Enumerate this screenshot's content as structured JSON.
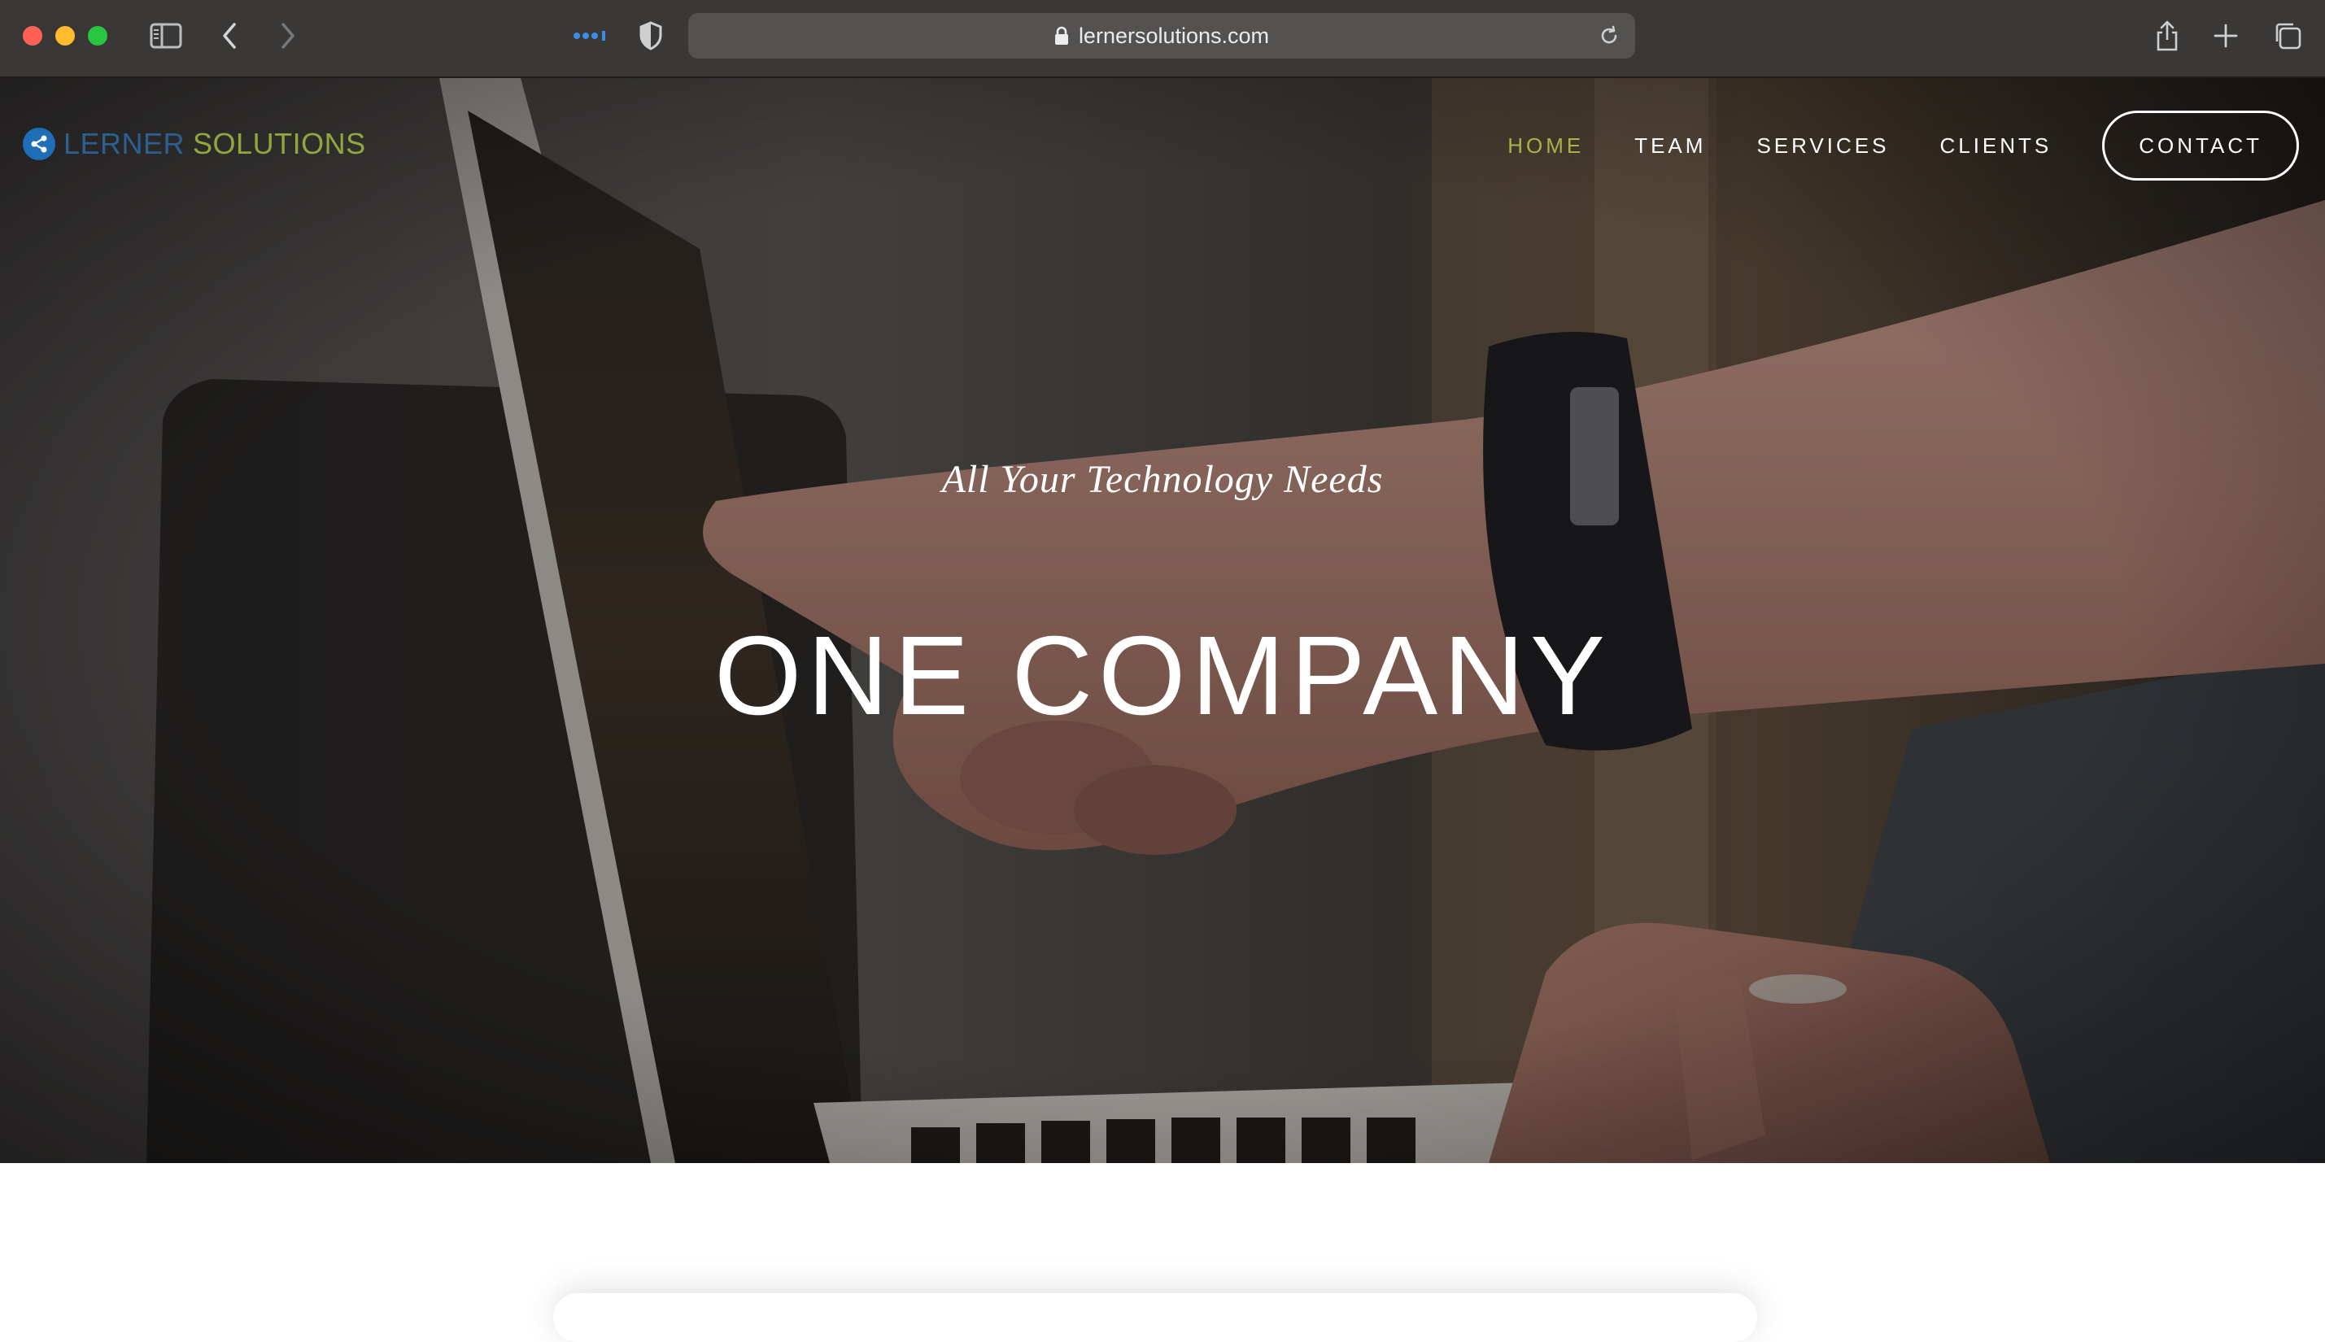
{
  "browser": {
    "url": "lernersolutions.com"
  },
  "site": {
    "logo_part1": "LERNER",
    "logo_part2": "SOLUTIONS",
    "nav": {
      "home": "HOME",
      "team": "TEAM",
      "services": "SERVICES",
      "clients": "CLIENTS",
      "contact": "CONTACT"
    },
    "hero": {
      "tagline": "All Your Technology Needs",
      "headline": "ONE COMPANY"
    }
  },
  "colors": {
    "accent_green": "#a6b448",
    "logo_blue": "#2d5f8f",
    "chrome_bg": "#3a3837"
  }
}
